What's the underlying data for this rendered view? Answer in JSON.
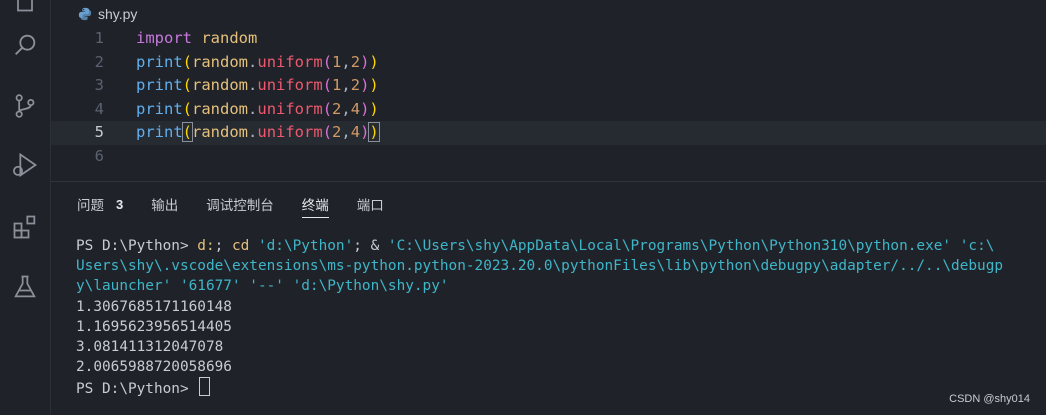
{
  "editor": {
    "filename": "shy.py",
    "lines": [
      {
        "n": "1",
        "parts": [
          [
            "import",
            "kw"
          ],
          [
            " ",
            ""
          ],
          [
            "random",
            "mod"
          ]
        ]
      },
      {
        "n": "2",
        "parts": [
          [
            "print",
            "fn"
          ],
          [
            "(",
            "paren2"
          ],
          [
            "random",
            "mod"
          ],
          [
            ".",
            "punc"
          ],
          [
            "uniform",
            "meth"
          ],
          [
            "(",
            "paren"
          ],
          [
            "1",
            "num"
          ],
          [
            ",",
            "punc"
          ],
          [
            "2",
            "num"
          ],
          [
            ")",
            "paren"
          ],
          [
            ")",
            "paren2"
          ]
        ]
      },
      {
        "n": "3",
        "parts": [
          [
            "print",
            "fn"
          ],
          [
            "(",
            "paren2"
          ],
          [
            "random",
            "mod"
          ],
          [
            ".",
            "punc"
          ],
          [
            "uniform",
            "meth"
          ],
          [
            "(",
            "paren"
          ],
          [
            "1",
            "num"
          ],
          [
            ",",
            "punc"
          ],
          [
            "2",
            "num"
          ],
          [
            ")",
            "paren"
          ],
          [
            ")",
            "paren2"
          ]
        ]
      },
      {
        "n": "4",
        "parts": [
          [
            "print",
            "fn"
          ],
          [
            "(",
            "paren2"
          ],
          [
            "random",
            "mod"
          ],
          [
            ".",
            "punc"
          ],
          [
            "uniform",
            "meth"
          ],
          [
            "(",
            "paren"
          ],
          [
            "2",
            "num"
          ],
          [
            ",",
            "punc"
          ],
          [
            "4",
            "num"
          ],
          [
            ")",
            "paren"
          ],
          [
            ")",
            "paren2"
          ]
        ]
      },
      {
        "n": "5",
        "parts": [
          [
            "print",
            "fn"
          ],
          [
            "(",
            "paren2 bracket-box"
          ],
          [
            "random",
            "mod"
          ],
          [
            ".",
            "punc"
          ],
          [
            "uniform",
            "meth"
          ],
          [
            "(",
            "paren"
          ],
          [
            "2",
            "num"
          ],
          [
            ",",
            "punc"
          ],
          [
            "4",
            "num"
          ],
          [
            ")",
            "paren"
          ],
          [
            ")",
            "paren2 bracket-box"
          ]
        ]
      },
      {
        "n": "6",
        "parts": []
      }
    ],
    "active_line": 5
  },
  "panel": {
    "tabs": [
      {
        "label": "问题",
        "badge": "3"
      },
      {
        "label": "输出"
      },
      {
        "label": "调试控制台"
      },
      {
        "label": "终端",
        "selected": true
      },
      {
        "label": "端口"
      }
    ]
  },
  "terminal": {
    "prompt1": "PS D:\\Python> ",
    "cmd_line1": " d:; cd 'd:\\Python'; & 'C:\\Users\\shy\\AppData\\Local\\Programs\\Python\\Python310\\python.exe' 'c:\\",
    "cmd_line2": "Users\\shy\\.vscode\\extensions\\ms-python.python-2023.20.0\\pythonFiles\\lib\\python\\debugpy\\adapter/../..\\debugp",
    "cmd_line3": "y\\launcher' '61677' '--' 'd:\\Python\\shy.py'",
    "outputs": [
      "1.3067685171160148",
      "1.1695623956514405",
      "3.081411312047078",
      "2.0065988720058696"
    ],
    "prompt2": "PS D:\\Python> "
  },
  "watermark": "CSDN @shy014",
  "icons": [
    "explorer-icon",
    "search-icon",
    "source-control-icon",
    "run-debug-icon",
    "extensions-icon",
    "testing-icon",
    "python-file-icon"
  ],
  "colors": {
    "background": "#1f2329",
    "cyan": "#3fb5c8",
    "yellow": "#e5c07b"
  }
}
